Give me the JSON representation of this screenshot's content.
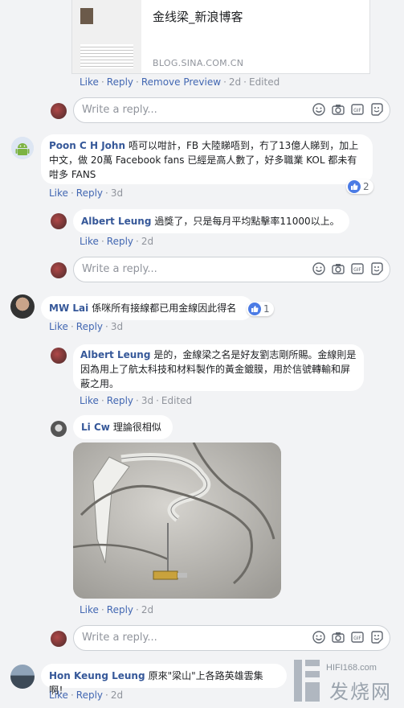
{
  "link_preview": {
    "title": "金线梁_新浪博客",
    "domain": "BLOG.SINA.COM.CN"
  },
  "actions": {
    "like": "Like",
    "reply": "Reply",
    "remove_preview": "Remove Preview",
    "edited": "Edited"
  },
  "reply_placeholder": "Write a reply...",
  "comments": [
    {
      "author": "Poon C H John",
      "text": "唔可以咁計，FB 大陸睇唔到，冇了13億人睇到，加上中文，做 20萬 Facebook fans 已經是高人數了，好多職業 KOL 都未有咁多 FANS",
      "time": "3d",
      "likes": "2",
      "replies": [
        {
          "author": "Albert Leung",
          "text": "過獎了，只是每月平均點擊率11000以上。",
          "time": "2d"
        }
      ]
    },
    {
      "author": "MW Lai",
      "text": "係咪所有接線都已用金線因此得名",
      "time": "3d",
      "likes": "1",
      "replies": [
        {
          "author": "Albert Leung",
          "text": "是的，金線梁之名是好友劉志剛所賜。金線則是因為用上了航太科技和材料製作的黃金鍍膜，用於信號轉輸和屏蔽之用。",
          "time": "3d"
        },
        {
          "author": "Li Cw",
          "text": "理論很相似",
          "time": "2d"
        }
      ]
    },
    {
      "author": "Hon Keung Leung",
      "text": "原來\"梁山\"上各路英雄雲集啊！",
      "time": "2d"
    }
  ],
  "top_time": "2d",
  "watermark": {
    "site": "HIFI168.com",
    "name": "发烧网"
  },
  "colors": {
    "link": "#4267b2",
    "name": "#365899",
    "like_blue": "#4b7be5"
  }
}
